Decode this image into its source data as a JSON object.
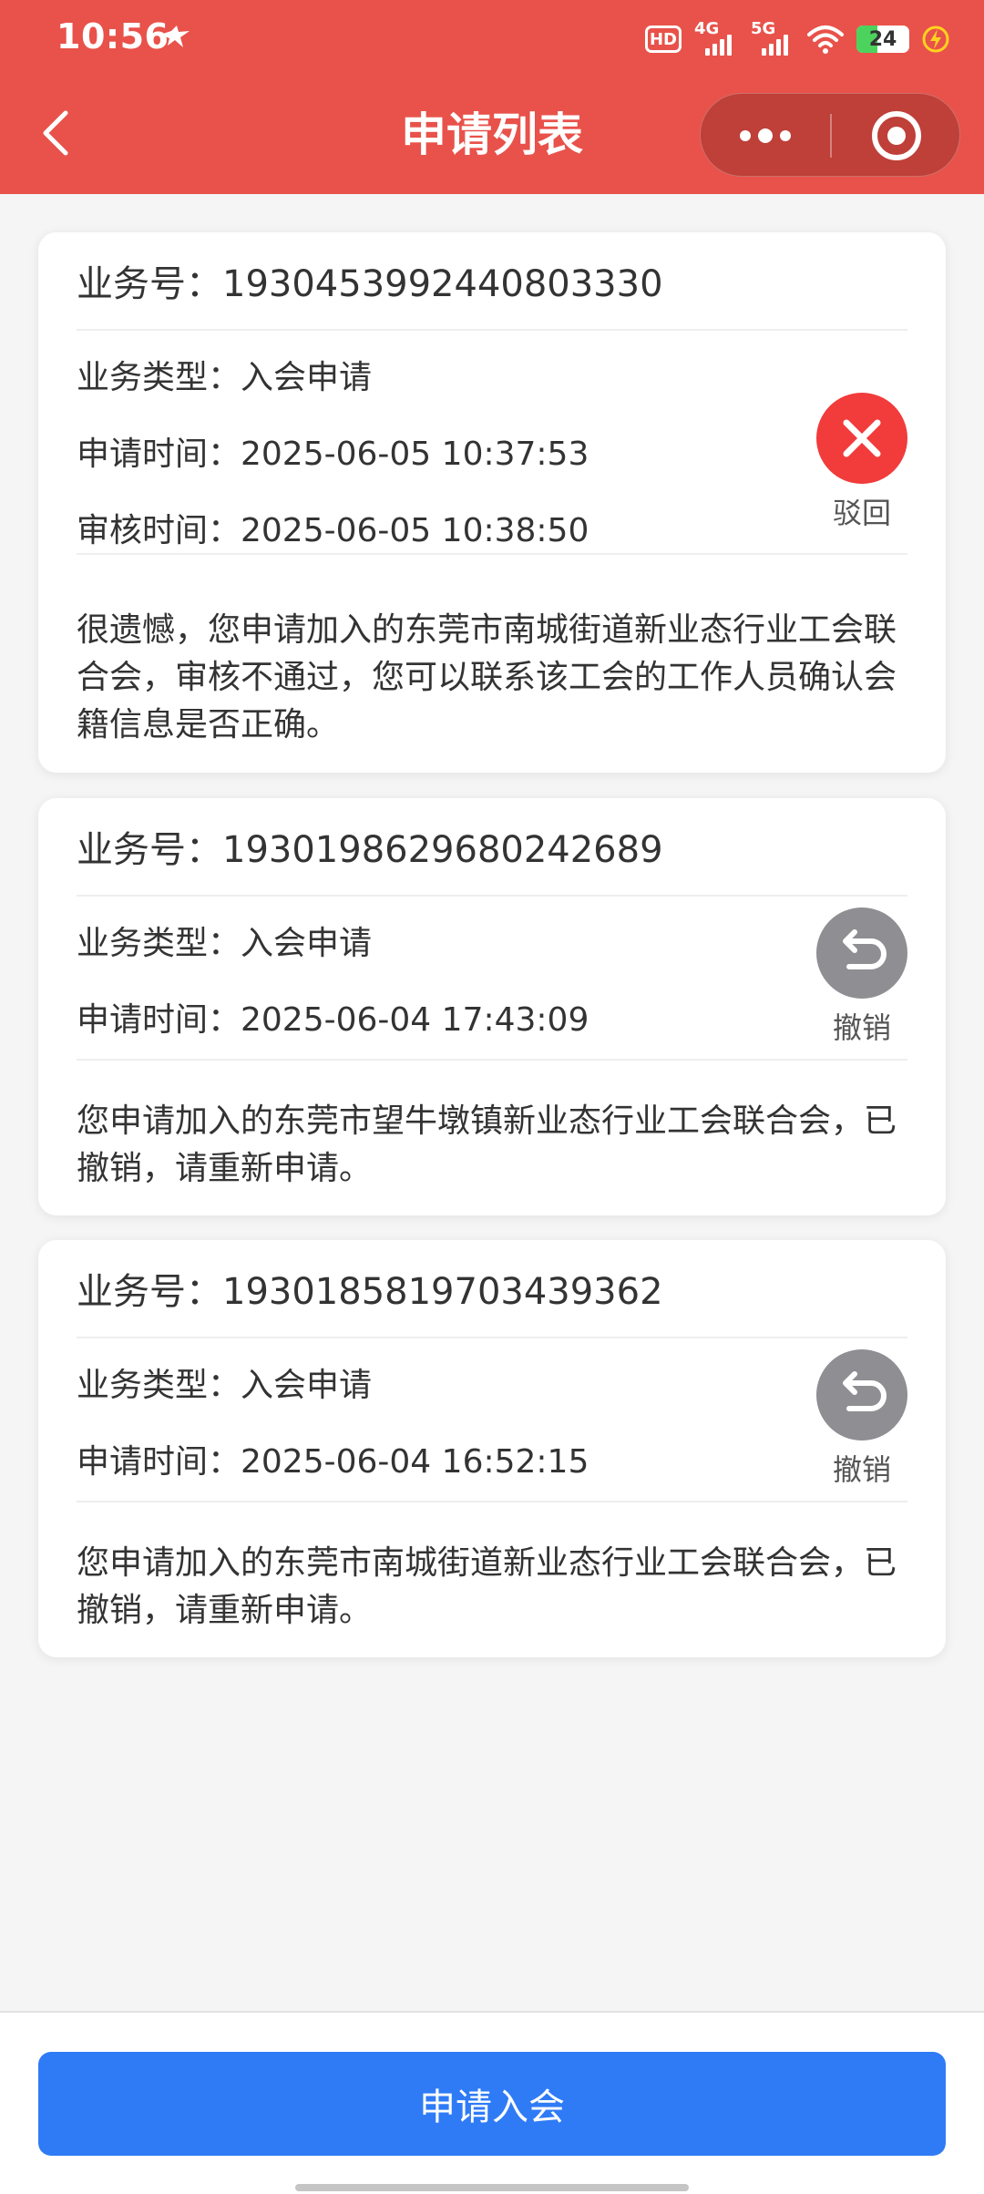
{
  "status_bar": {
    "time": "10:56",
    "hd_label": "HD",
    "network_1": "4G",
    "network_2": "5G",
    "battery": "24"
  },
  "nav": {
    "title": "申请列表"
  },
  "colors": {
    "header_red": "#e8524a",
    "reject_red": "#f23b3b",
    "revoke_gray": "#8e8e93",
    "primary_blue": "#2f7bf6"
  },
  "applications": [
    {
      "business_no": "业务号：1930453992440803330",
      "type": "业务类型：入会申请",
      "apply_time": "申请时间：2025-06-05 10:37:53",
      "review_time": "审核时间：2025-06-05 10:38:50",
      "status": "驳回",
      "status_icon": "close-circle-icon",
      "message": "很遗憾，您申请加入的东莞市南城街道新业态行业工会联合会，审核不通过，您可以联系该工会的工作人员确认会籍信息是否正确。"
    },
    {
      "business_no": "业务号：1930198629680242689",
      "type": "业务类型：入会申请",
      "apply_time": "申请时间：2025-06-04 17:43:09",
      "status": "撤销",
      "status_icon": "undo-circle-icon",
      "message": "您申请加入的东莞市望牛墩镇新业态行业工会联合会，已撤销，请重新申请。"
    },
    {
      "business_no": "业务号：1930185819703439362",
      "type": "业务类型：入会申请",
      "apply_time": "申请时间：2025-06-04 16:52:15",
      "status": "撤销",
      "status_icon": "undo-circle-icon",
      "message": "您申请加入的东莞市南城街道新业态行业工会联合会，已撤销，请重新申请。"
    }
  ],
  "footer": {
    "apply_button": "申请入会"
  }
}
